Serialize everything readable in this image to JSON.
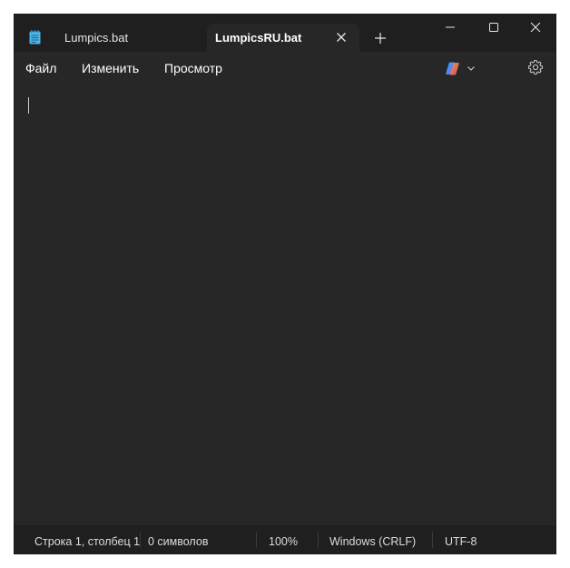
{
  "tabs": [
    {
      "label": "Lumpics.bat",
      "active": false
    },
    {
      "label": "LumpicsRU.bat",
      "active": true
    }
  ],
  "icons": {
    "app": "notepad-icon",
    "tab_close": "close-icon",
    "new_tab": "plus-icon",
    "minimize": "minimize-icon",
    "maximize": "maximize-icon",
    "close": "close-icon",
    "copilot": "copilot-icon",
    "copilot_menu": "chevron-down-icon",
    "settings": "gear-icon"
  },
  "menu": {
    "file": "Файл",
    "edit": "Изменить",
    "view": "Просмотр"
  },
  "editor": {
    "content": ""
  },
  "status": {
    "position": "Строка 1, столбец 1",
    "chars": "0 символов",
    "zoom": "100%",
    "line_ending": "Windows (CRLF)",
    "encoding": "UTF-8"
  },
  "colors": {
    "window_bg": "#272727",
    "titlebar_bg": "#1f1f1f",
    "text": "#ffffff"
  }
}
